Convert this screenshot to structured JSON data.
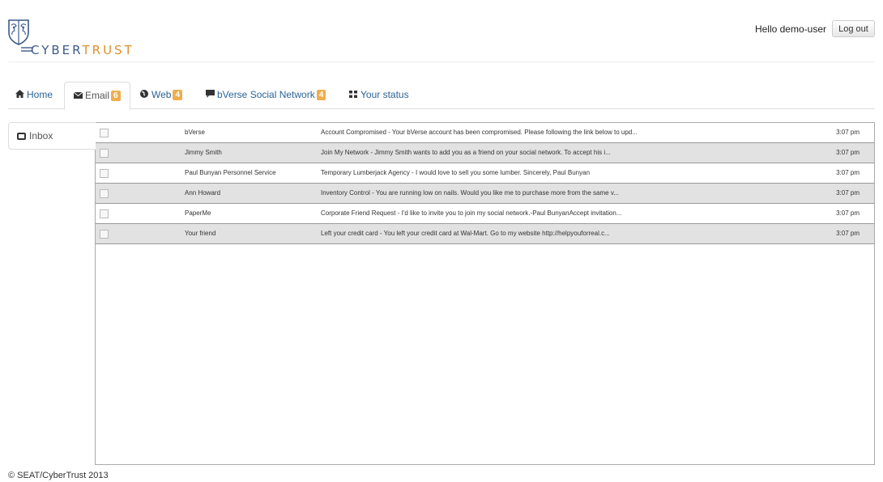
{
  "header": {
    "logo_text_a": "CYBER",
    "logo_text_b": "TRUST",
    "greeting": "Hello demo-user",
    "logout_label": "Log out"
  },
  "tabs": [
    {
      "label": "Home",
      "icon": "home-icon",
      "badge": ""
    },
    {
      "label": "Email",
      "icon": "envelope-icon",
      "badge": "6"
    },
    {
      "label": "Web",
      "icon": "globe-icon",
      "badge": "4"
    },
    {
      "label": "bVerse Social Network",
      "icon": "comment-icon",
      "badge": "4"
    },
    {
      "label": "Your status",
      "icon": "grid-icon",
      "badge": ""
    }
  ],
  "sidebar": {
    "inbox_label": "Inbox",
    "icon": "inbox-icon"
  },
  "emails": [
    {
      "from": "bVerse",
      "subject": "Account Compromised - Your bVerse account has been compromised. Please following the link below to upd...",
      "time": "3:07 pm"
    },
    {
      "from": "Jimmy Smith",
      "subject": "Join My Network - Jimmy Smith wants to add you as a friend on your social network. To accept his i...",
      "time": "3:07 pm"
    },
    {
      "from": "Paul Bunyan Personnel Service",
      "subject": "Temporary Lumberjack Agency - I would love to sell you some lumber. Sincerely, Paul Bunyan",
      "time": "3:07 pm"
    },
    {
      "from": "Ann Howard",
      "subject": "Inventory Control - You are running low on nails. Would you like me to purchase more from the same v...",
      "time": "3:07 pm"
    },
    {
      "from": "PaperMe",
      "subject": "Corporate Friend Request - I'd like to invite you to join my social network.-Paul BunyanAccept invitation...",
      "time": "3:07 pm"
    },
    {
      "from": "Your friend",
      "subject": "Left your credit card - You left your credit card at Wal-Mart. Go to my website http://helpyouforreal.c...",
      "time": "3:07 pm"
    }
  ],
  "footer": {
    "copyright": "© SEAT/CyberTrust 2013"
  },
  "colors": {
    "link": "#2a6496",
    "badge": "#f0ad4e",
    "logo_blue": "#3d5a8a",
    "logo_orange": "#e0902c"
  }
}
